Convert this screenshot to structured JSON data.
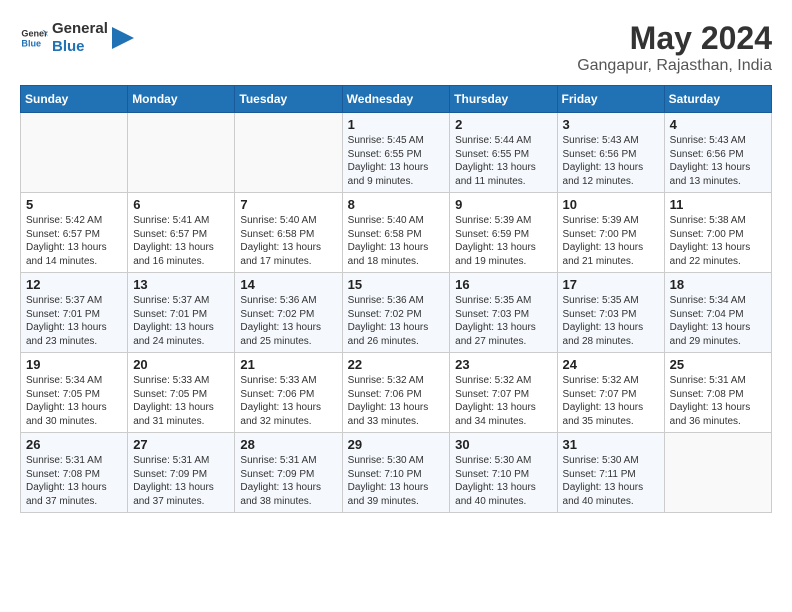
{
  "header": {
    "logo_line1": "General",
    "logo_line2": "Blue",
    "month": "May 2024",
    "location": "Gangapur, Rajasthan, India"
  },
  "weekdays": [
    "Sunday",
    "Monday",
    "Tuesday",
    "Wednesday",
    "Thursday",
    "Friday",
    "Saturday"
  ],
  "weeks": [
    [
      {
        "day": "",
        "info": ""
      },
      {
        "day": "",
        "info": ""
      },
      {
        "day": "",
        "info": ""
      },
      {
        "day": "1",
        "info": "Sunrise: 5:45 AM\nSunset: 6:55 PM\nDaylight: 13 hours\nand 9 minutes."
      },
      {
        "day": "2",
        "info": "Sunrise: 5:44 AM\nSunset: 6:55 PM\nDaylight: 13 hours\nand 11 minutes."
      },
      {
        "day": "3",
        "info": "Sunrise: 5:43 AM\nSunset: 6:56 PM\nDaylight: 13 hours\nand 12 minutes."
      },
      {
        "day": "4",
        "info": "Sunrise: 5:43 AM\nSunset: 6:56 PM\nDaylight: 13 hours\nand 13 minutes."
      }
    ],
    [
      {
        "day": "5",
        "info": "Sunrise: 5:42 AM\nSunset: 6:57 PM\nDaylight: 13 hours\nand 14 minutes."
      },
      {
        "day": "6",
        "info": "Sunrise: 5:41 AM\nSunset: 6:57 PM\nDaylight: 13 hours\nand 16 minutes."
      },
      {
        "day": "7",
        "info": "Sunrise: 5:40 AM\nSunset: 6:58 PM\nDaylight: 13 hours\nand 17 minutes."
      },
      {
        "day": "8",
        "info": "Sunrise: 5:40 AM\nSunset: 6:58 PM\nDaylight: 13 hours\nand 18 minutes."
      },
      {
        "day": "9",
        "info": "Sunrise: 5:39 AM\nSunset: 6:59 PM\nDaylight: 13 hours\nand 19 minutes."
      },
      {
        "day": "10",
        "info": "Sunrise: 5:39 AM\nSunset: 7:00 PM\nDaylight: 13 hours\nand 21 minutes."
      },
      {
        "day": "11",
        "info": "Sunrise: 5:38 AM\nSunset: 7:00 PM\nDaylight: 13 hours\nand 22 minutes."
      }
    ],
    [
      {
        "day": "12",
        "info": "Sunrise: 5:37 AM\nSunset: 7:01 PM\nDaylight: 13 hours\nand 23 minutes."
      },
      {
        "day": "13",
        "info": "Sunrise: 5:37 AM\nSunset: 7:01 PM\nDaylight: 13 hours\nand 24 minutes."
      },
      {
        "day": "14",
        "info": "Sunrise: 5:36 AM\nSunset: 7:02 PM\nDaylight: 13 hours\nand 25 minutes."
      },
      {
        "day": "15",
        "info": "Sunrise: 5:36 AM\nSunset: 7:02 PM\nDaylight: 13 hours\nand 26 minutes."
      },
      {
        "day": "16",
        "info": "Sunrise: 5:35 AM\nSunset: 7:03 PM\nDaylight: 13 hours\nand 27 minutes."
      },
      {
        "day": "17",
        "info": "Sunrise: 5:35 AM\nSunset: 7:03 PM\nDaylight: 13 hours\nand 28 minutes."
      },
      {
        "day": "18",
        "info": "Sunrise: 5:34 AM\nSunset: 7:04 PM\nDaylight: 13 hours\nand 29 minutes."
      }
    ],
    [
      {
        "day": "19",
        "info": "Sunrise: 5:34 AM\nSunset: 7:05 PM\nDaylight: 13 hours\nand 30 minutes."
      },
      {
        "day": "20",
        "info": "Sunrise: 5:33 AM\nSunset: 7:05 PM\nDaylight: 13 hours\nand 31 minutes."
      },
      {
        "day": "21",
        "info": "Sunrise: 5:33 AM\nSunset: 7:06 PM\nDaylight: 13 hours\nand 32 minutes."
      },
      {
        "day": "22",
        "info": "Sunrise: 5:32 AM\nSunset: 7:06 PM\nDaylight: 13 hours\nand 33 minutes."
      },
      {
        "day": "23",
        "info": "Sunrise: 5:32 AM\nSunset: 7:07 PM\nDaylight: 13 hours\nand 34 minutes."
      },
      {
        "day": "24",
        "info": "Sunrise: 5:32 AM\nSunset: 7:07 PM\nDaylight: 13 hours\nand 35 minutes."
      },
      {
        "day": "25",
        "info": "Sunrise: 5:31 AM\nSunset: 7:08 PM\nDaylight: 13 hours\nand 36 minutes."
      }
    ],
    [
      {
        "day": "26",
        "info": "Sunrise: 5:31 AM\nSunset: 7:08 PM\nDaylight: 13 hours\nand 37 minutes."
      },
      {
        "day": "27",
        "info": "Sunrise: 5:31 AM\nSunset: 7:09 PM\nDaylight: 13 hours\nand 37 minutes."
      },
      {
        "day": "28",
        "info": "Sunrise: 5:31 AM\nSunset: 7:09 PM\nDaylight: 13 hours\nand 38 minutes."
      },
      {
        "day": "29",
        "info": "Sunrise: 5:30 AM\nSunset: 7:10 PM\nDaylight: 13 hours\nand 39 minutes."
      },
      {
        "day": "30",
        "info": "Sunrise: 5:30 AM\nSunset: 7:10 PM\nDaylight: 13 hours\nand 40 minutes."
      },
      {
        "day": "31",
        "info": "Sunrise: 5:30 AM\nSunset: 7:11 PM\nDaylight: 13 hours\nand 40 minutes."
      },
      {
        "day": "",
        "info": ""
      }
    ]
  ]
}
